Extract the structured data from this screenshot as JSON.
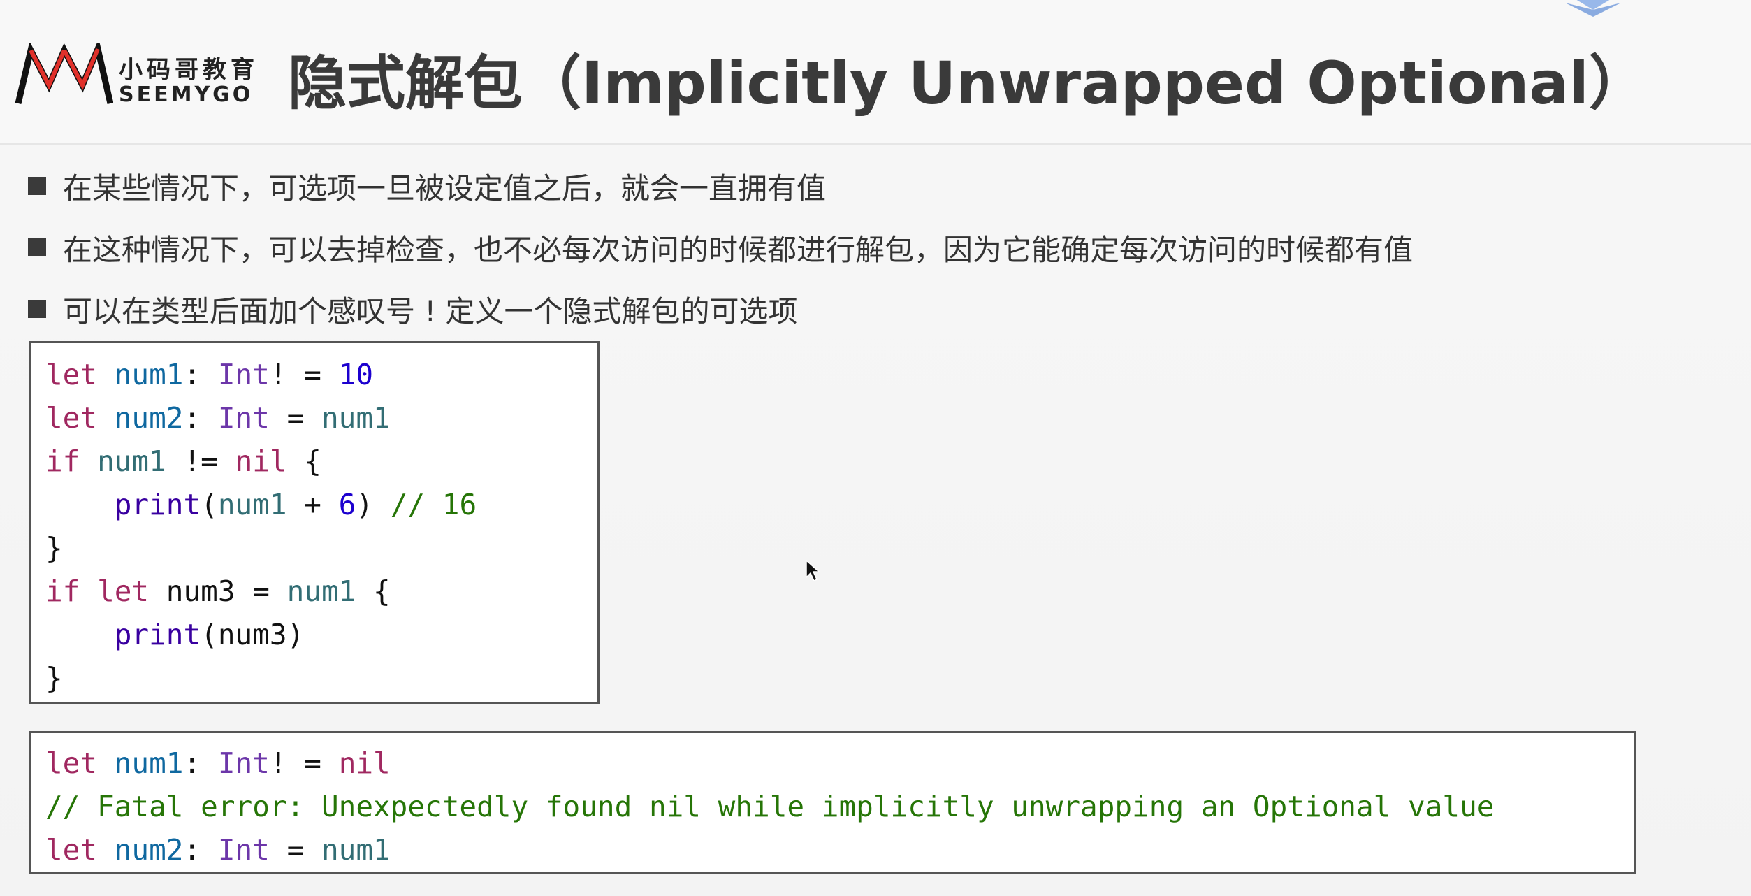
{
  "header": {
    "logo_cn": "小码哥教育",
    "logo_en": "SEEMYGO",
    "title": "隐式解包（Implicitly Unwrapped Optional）"
  },
  "bullets": [
    "在某些情况下，可选项一旦被设定值之后，就会一直拥有值",
    "在这种情况下，可以去掉检查，也不必每次访问的时候都进行解包，因为它能确定每次访问的时候都有值",
    "可以在类型后面加个感叹号 ! 定义一个隐式解包的可选项"
  ],
  "code1": {
    "l1": {
      "a": "let",
      "b": " ",
      "c": "num1",
      "d": ": ",
      "e": "Int",
      "f": "! = ",
      "g": "10"
    },
    "l2": {
      "a": "let",
      "b": " ",
      "c": "num2",
      "d": ": ",
      "e": "Int",
      "f": " = ",
      "g": "num1"
    },
    "l3": {
      "a": "if",
      "b": " ",
      "c": "num1",
      "d": " != ",
      "e": "nil",
      "f": " {"
    },
    "l4": {
      "a": "    ",
      "b": "print",
      "c": "(",
      "d": "num1",
      "e": " + ",
      "f": "6",
      "g": ") ",
      "h": "// 16"
    },
    "l5": "}",
    "l6": {
      "a": "if",
      "b": " ",
      "c": "let",
      "d": " num3 = ",
      "e": "num1",
      "f": " {"
    },
    "l7": {
      "a": "    ",
      "b": "print",
      "c": "(num3)"
    },
    "l8": "}"
  },
  "code2": {
    "l1": {
      "a": "let",
      "b": " ",
      "c": "num1",
      "d": ": ",
      "e": "Int",
      "f": "! = ",
      "g": "nil"
    },
    "l2": "// Fatal error: Unexpectedly found nil while implicitly unwrapping an Optional value",
    "l3": {
      "a": "let",
      "b": " ",
      "c": "num2",
      "d": ": ",
      "e": "Int",
      "f": " = ",
      "g": "num1"
    }
  },
  "colors": {
    "keyword": "#9b2393",
    "type": "#6c36a9",
    "identifier": "#0f68a0",
    "reference": "#326d74",
    "number": "#1c00cf",
    "comment": "#267507"
  },
  "icons": [
    "seemygo-logo-icon",
    "mouse-cursor-icon"
  ]
}
